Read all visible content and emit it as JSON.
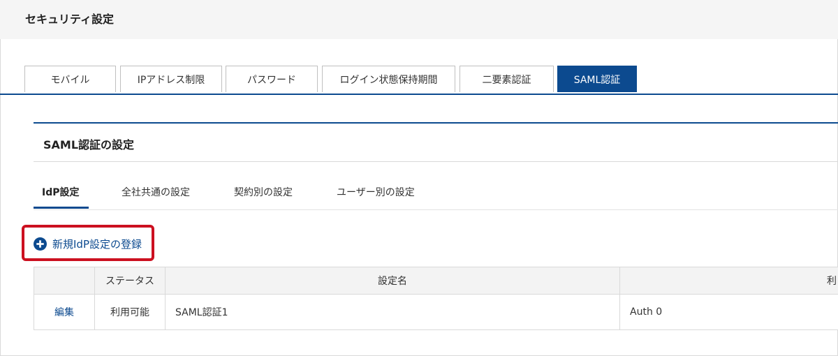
{
  "page": {
    "title": "セキュリティ設定"
  },
  "tabs": [
    {
      "label": "モバイル",
      "active": false
    },
    {
      "label": "IPアドレス制限",
      "active": false
    },
    {
      "label": "パスワード",
      "active": false
    },
    {
      "label": "ログイン状態保持期間",
      "active": false
    },
    {
      "label": "二要素認証",
      "active": false
    },
    {
      "label": "SAML認証",
      "active": true
    }
  ],
  "panel": {
    "title": "SAML認証の設定",
    "subtabs": [
      {
        "label": "IdP設定",
        "active": true
      },
      {
        "label": "全社共通の設定",
        "active": false
      },
      {
        "label": "契約別の設定",
        "active": false
      },
      {
        "label": "ユーザー別の設定",
        "active": false
      }
    ],
    "add_button": {
      "label": "新規IdP設定の登録",
      "icon": "plus-circle-icon"
    },
    "table": {
      "headers": [
        "",
        "ステータス",
        "設定名",
        "利"
      ],
      "rows": [
        {
          "action": "編集",
          "status": "利用可能",
          "name": "SAML認証1",
          "provider": "Auth 0"
        }
      ]
    }
  },
  "colors": {
    "accent": "#0c4a8f",
    "highlight": "#cc1020",
    "header_bg": "#f5f5f5"
  }
}
